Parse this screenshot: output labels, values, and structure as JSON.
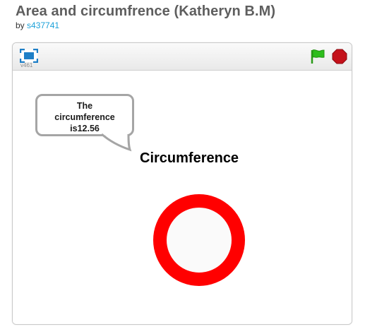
{
  "project": {
    "title": "Area and circumfrence (Katheryn B.M)",
    "by_prefix": "by",
    "author": "s437741"
  },
  "player": {
    "version": "v461",
    "fullscreen_icon": "fullscreen-icon",
    "green_flag_icon": "green-flag-icon",
    "stop_icon": "stop-sign-icon"
  },
  "stage": {
    "speech_bubble_text": "The\ncircumference\nis12.56",
    "sprite_text": "Circumference",
    "circle_fill": "#fafafa",
    "circle_ring_color": "#ff0000"
  },
  "colors": {
    "title": "#5e5e5e",
    "author_link": "#1aa0d8",
    "flag": "#2dbd1c",
    "stop": "#c4111a",
    "fullscreen": "#1e7fc7"
  }
}
